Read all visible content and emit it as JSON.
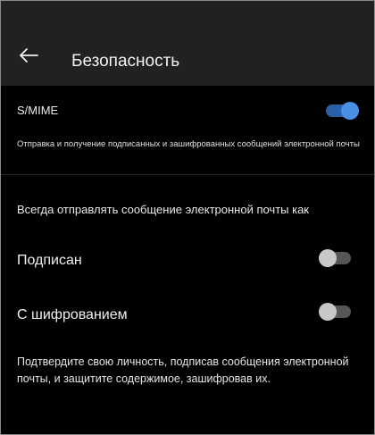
{
  "header": {
    "title": "Безопасность",
    "back_icon": "arrow-left-icon"
  },
  "smime": {
    "label": "S/MIME",
    "enabled": true,
    "description": "Отправка и получение подписанных и зашифрованных сообщений электронной почты"
  },
  "always_send": {
    "heading": "Всегда отправлять сообщение электронной почты как",
    "signed_label": "Подписан",
    "signed_enabled": false,
    "encrypted_label": "С шифрованием",
    "encrypted_enabled": false
  },
  "footer": {
    "text": "Подтвердите свою личность, подписав сообщения электронной почты, и защитите содержимое, зашифровав их."
  },
  "colors": {
    "header_bg": "#212121",
    "page_bg": "#000000",
    "toggle_on_knob": "#4a8fe6",
    "toggle_on_track": "#2b5fa8",
    "toggle_off_knob": "#c8c8c8",
    "toggle_off_track": "#565656"
  }
}
